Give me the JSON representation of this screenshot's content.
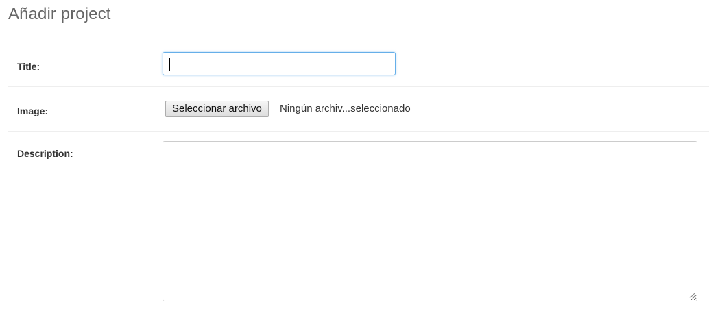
{
  "page": {
    "title": "Añadir project"
  },
  "form": {
    "title_field": {
      "label": "Title:",
      "value": ""
    },
    "image_field": {
      "label": "Image:",
      "button_label": "Seleccionar archivo",
      "status": "Ningún archiv...seleccionado"
    },
    "description_field": {
      "label": "Description:",
      "value": ""
    }
  },
  "colors": {
    "focus_border": "#66afe9",
    "divider": "#eeeeee",
    "title_text": "#666666"
  },
  "icons": {
    "resize": "resize-grip-icon"
  }
}
